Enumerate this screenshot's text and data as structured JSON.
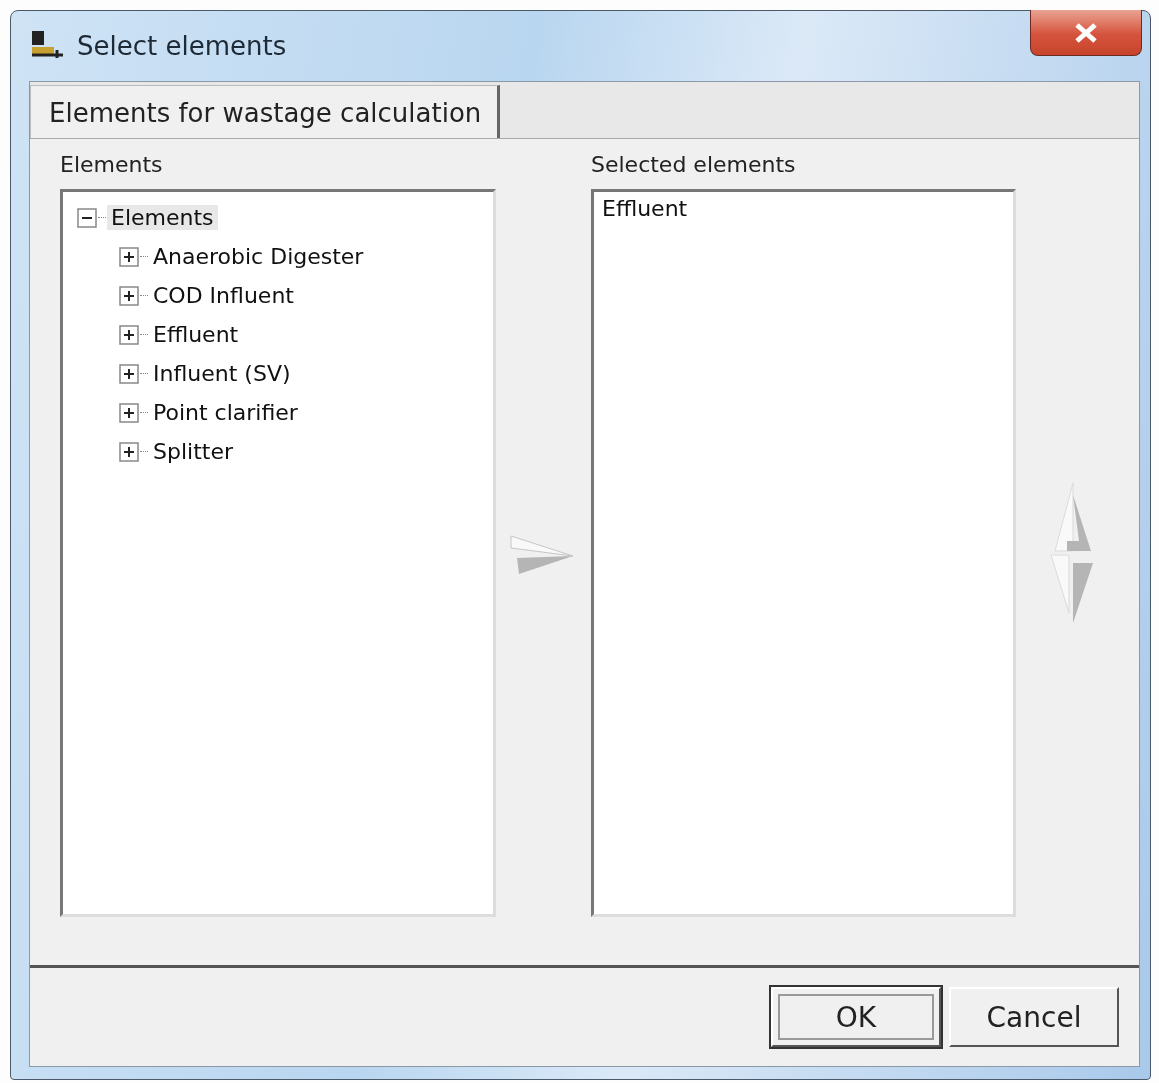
{
  "window": {
    "title": "Select elements"
  },
  "tabs": [
    {
      "label": "Elements for wastage calculation",
      "selected": true
    }
  ],
  "left_panel": {
    "label": "Elements",
    "tree": {
      "label": "Elements",
      "expanded": true,
      "selected": true,
      "children": [
        {
          "label": "Anaerobic Digester",
          "expanded": false,
          "selected": false
        },
        {
          "label": "COD Influent",
          "expanded": false,
          "selected": false
        },
        {
          "label": "Effluent",
          "expanded": false,
          "selected": false
        },
        {
          "label": "Influent (SV)",
          "expanded": false,
          "selected": false
        },
        {
          "label": "Point clarifier",
          "expanded": false,
          "selected": false
        },
        {
          "label": "Splitter",
          "expanded": false,
          "selected": false
        }
      ]
    }
  },
  "add_button": {
    "disabled": true
  },
  "right_panel": {
    "label": "Selected elements",
    "items": [
      {
        "label": "Effluent",
        "selected": false
      }
    ]
  },
  "reorder_buttons": {
    "disabled": true
  },
  "buttons": [
    {
      "label": "OK",
      "default": true
    },
    {
      "label": "Cancel",
      "default": false
    }
  ]
}
